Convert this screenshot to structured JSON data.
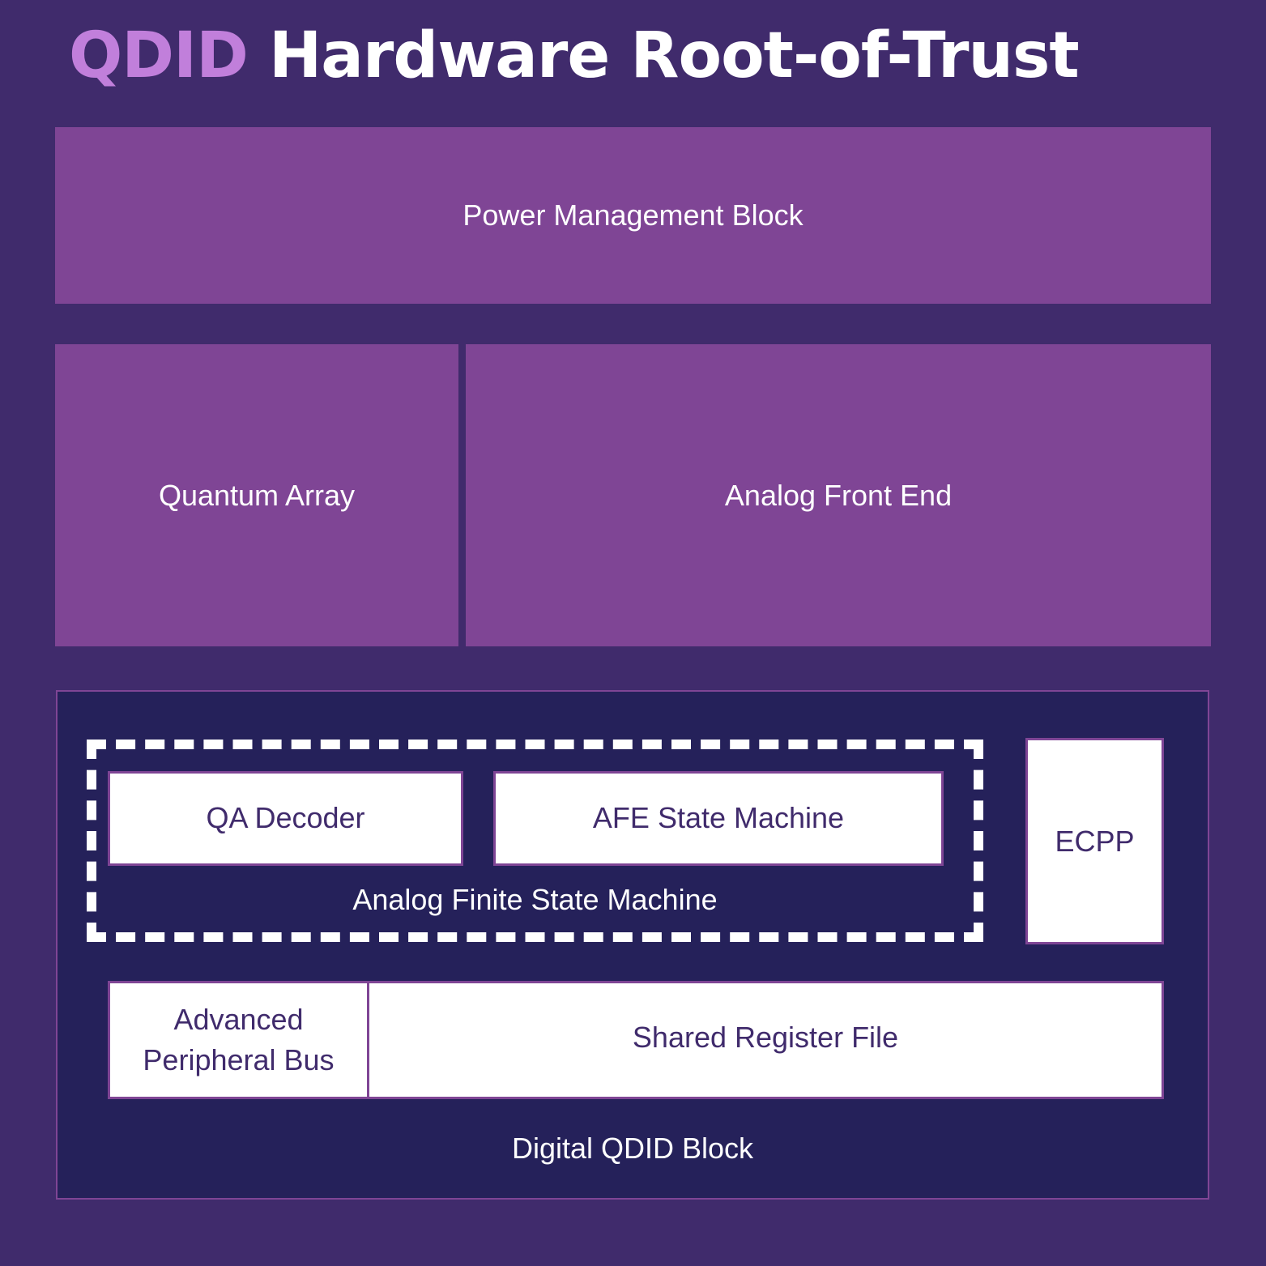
{
  "title": {
    "accent": "QDID",
    "rest": "Hardware Root-of-Trust"
  },
  "colors": {
    "background": "#402b6c",
    "block": "#7f4595",
    "digital_bg": "#25215a",
    "accent": "#c17fdb",
    "inner_text": "#402b6c"
  },
  "blocks": {
    "power": "Power Management Block",
    "quantum_array": "Quantum Array",
    "afe": "Analog Front End"
  },
  "digital": {
    "label": "Digital QDID Block",
    "afsm": {
      "label": "Analog Finite State Machine",
      "qa_decoder": "QA Decoder",
      "afe_state_machine": "AFE State Machine"
    },
    "ecpp": "ECPP",
    "apb": "Advanced Peripheral Bus",
    "srf": "Shared Register File"
  }
}
